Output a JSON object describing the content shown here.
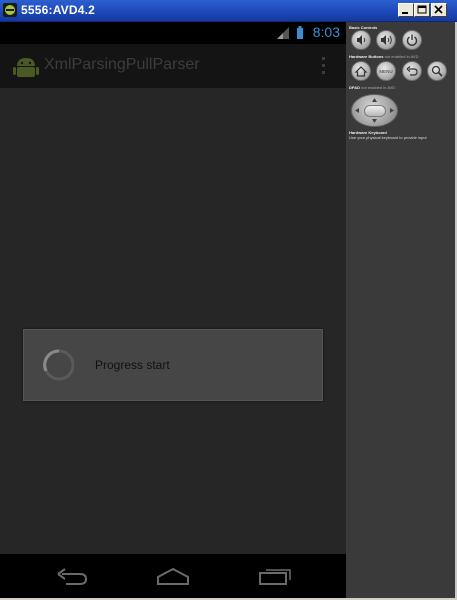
{
  "window": {
    "title": "5556:AVD4.2",
    "minimize_label": "Minimize",
    "maximize_label": "Maximize",
    "close_label": "Close"
  },
  "phone": {
    "status_time": "8:03",
    "app_title": "XmlParsingPullParser",
    "dialog_message": "Progress start",
    "accent_color": "#3a8fd0"
  },
  "controls": {
    "basic_controls_label": "Basic Controls",
    "hardware_buttons_label": "Hardware Buttons",
    "hardware_buttons_note": "not enabled in AVD",
    "dpad_label": "DPAD",
    "dpad_note": "not enabled in AVD",
    "keyboard_label": "Hardware Keyboard",
    "keyboard_note": "Use your physical keyboard to provide input",
    "menu_button_label": "MENU",
    "basic_buttons": [
      "volume-down-icon",
      "volume-up-icon",
      "power-icon"
    ],
    "hardware_buttons": [
      "home-icon",
      "menu-icon",
      "back-icon",
      "search-icon"
    ]
  }
}
